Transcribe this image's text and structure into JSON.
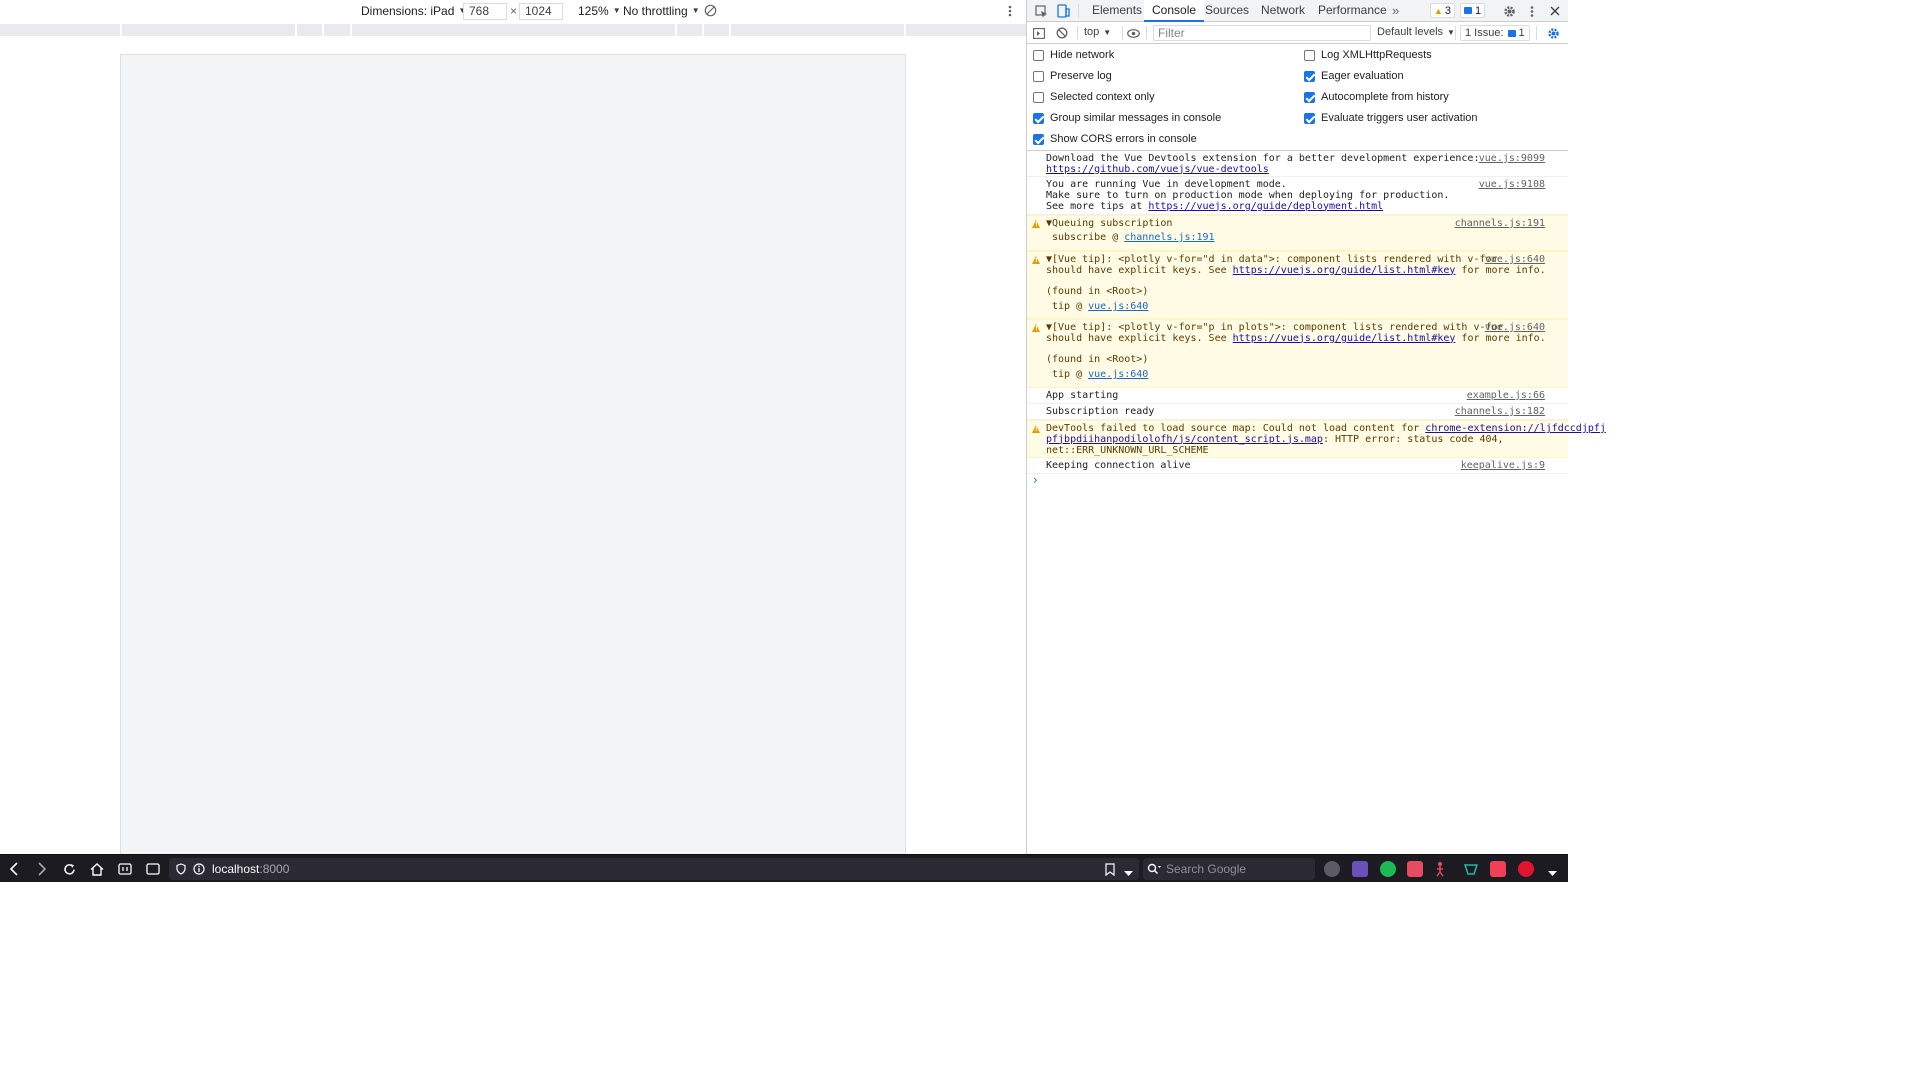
{
  "device_toolbar": {
    "dimensions_label": "Dimensions: iPad",
    "width": "768",
    "times": "×",
    "height": "1024",
    "zoom": "125%",
    "throttling": "No throttling"
  },
  "devtools": {
    "tabs": [
      "Elements",
      "Console",
      "Sources",
      "Network",
      "Performance"
    ],
    "more_tabs": "»",
    "warnings_count": "3",
    "messages_count": "1",
    "toolbar": {
      "context": "top",
      "filter_placeholder": "Filter",
      "levels": "Default levels",
      "issues_label": "1 Issue:",
      "issues_count": "1"
    },
    "settings": {
      "left": [
        {
          "label": "Hide network",
          "checked": false
        },
        {
          "label": "Preserve log",
          "checked": false
        },
        {
          "label": "Selected context only",
          "checked": false
        },
        {
          "label": "Group similar messages in console",
          "checked": true
        },
        {
          "label": "Show CORS errors in console",
          "checked": true
        }
      ],
      "right": [
        {
          "label": "Log XMLHttpRequests",
          "checked": false
        },
        {
          "label": "Eager evaluation",
          "checked": true
        },
        {
          "label": "Autocomplete from history",
          "checked": true
        },
        {
          "label": "Evaluate triggers user activation",
          "checked": true
        }
      ]
    },
    "console": {
      "messages": [
        {
          "level": "info",
          "line1": "Download the Vue Devtools extension for a better development experience:",
          "link1": "https://github.com/vuejs/vue-devtools",
          "source": "vue.js:9099"
        },
        {
          "level": "info",
          "line1": "You are running Vue in development mode.",
          "line2": "Make sure to turn on production mode when deploying for production.",
          "line3_prefix": "See more tips at ",
          "link1": "https://vuejs.org/guide/deployment.html",
          "source": "vue.js:9108"
        },
        {
          "level": "warning",
          "line1": "▼Queuing subscription",
          "trace_prefix": "subscribe @ ",
          "trace_link": "channels.js:191",
          "source": "channels.js:191"
        },
        {
          "level": "warning",
          "line1": "▼[Vue tip]: <plotly v-for=\"d in data\">: component lists rendered with v-for",
          "line2_prefix": "should have explicit keys. See ",
          "link1": "https://vuejs.org/guide/list.html#key",
          "line2_suffix": " for more info.",
          "line3": "(found in <Root>)",
          "trace_prefix": "tip @ ",
          "trace_link": "vue.js:640",
          "source": "vue.js:640"
        },
        {
          "level": "warning",
          "line1": "▼[Vue tip]: <plotly v-for=\"p in plots\">: component lists rendered with v-for",
          "line2_prefix": "should have explicit keys. See ",
          "link1": "https://vuejs.org/guide/list.html#key",
          "line2_suffix": " for more info.",
          "line3": "(found in <Root>)",
          "trace_prefix": "tip @ ",
          "trace_link": "vue.js:640",
          "source": "vue.js:640"
        },
        {
          "level": "info",
          "line1": "App starting",
          "source": "example.js:66"
        },
        {
          "level": "info",
          "line1": "Subscription ready",
          "source": "channels.js:182"
        },
        {
          "level": "warning",
          "line1_prefix": "DevTools failed to load source map: Could not load content for ",
          "link1a": "chrome-extension://ljfdccdjpfj",
          "link1b": "pfjbpdiihanpodilolofh/js/content_script.js.map",
          "line2_suffix": ": HTTP error: status code 404,",
          "line3": "net::ERR_UNKNOWN_URL_SCHEME"
        },
        {
          "level": "info",
          "line1": "Keeping connection alive",
          "source": "keepalive.js:9"
        }
      ],
      "prompt": "›"
    }
  },
  "browser": {
    "url_host": "localhost",
    "url_port": ":8000",
    "search_placeholder": "Search Google"
  },
  "colors": {
    "accent": "#1a73e8",
    "warning_bg": "#fffbe5",
    "warning_icon": "#e2a000",
    "bottom_bar": "#1c1b22"
  }
}
